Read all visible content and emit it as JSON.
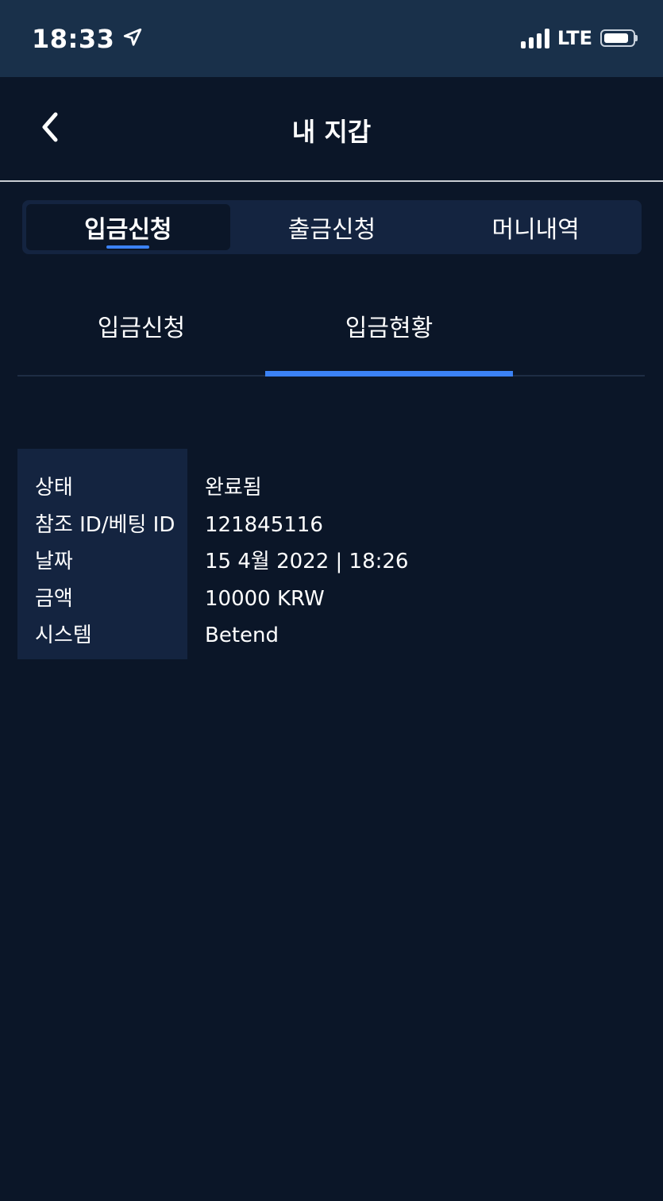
{
  "status_bar": {
    "time": "18:33",
    "network": "LTE",
    "icons": [
      "location-arrow-icon",
      "signal-icon",
      "battery-icon"
    ]
  },
  "header": {
    "title": "내 지갑",
    "back_icon": "chevron-left-icon"
  },
  "top_tabs": [
    {
      "label": "입금신청",
      "active": true
    },
    {
      "label": "출금신청",
      "active": false
    },
    {
      "label": "머니내역",
      "active": false
    }
  ],
  "sub_tabs": [
    {
      "label": "입금신청",
      "active": false
    },
    {
      "label": "입금현황",
      "active": true
    }
  ],
  "deposit_status": {
    "rows": [
      {
        "label": "상태",
        "value": "완료됨"
      },
      {
        "label": "참조 ID/베팅 ID",
        "value": "121845116"
      },
      {
        "label": "날짜",
        "value": "15 4월 2022 | 18:26"
      },
      {
        "label": "금액",
        "value": "10000 KRW"
      },
      {
        "label": "시스템",
        "value": "Betend"
      }
    ]
  },
  "colors": {
    "background": "#0b1628",
    "status_bar": "#19304a",
    "panel": "#142440",
    "accent": "#3b82f6"
  }
}
